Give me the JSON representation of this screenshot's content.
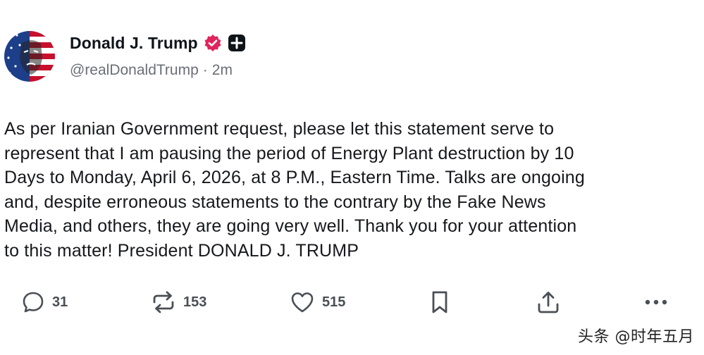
{
  "author": {
    "display_name": "Donald J. Trump",
    "handle": "@realDonaldTrump",
    "separator": "·",
    "time_ago": "2m",
    "verified_color": "#e0245e"
  },
  "post": {
    "lines": [
      "As per Iranian Government request, please let this statement serve to",
      "represent that I am pausing the period of Energy Plant destruction by 10",
      "Days to Monday, April 6, 2026, at 8 P.M., Eastern Time. Talks are ongoing",
      "and, despite erroneous statements to the contrary by the Fake News",
      "Media, and others, they are going very well. Thank you for your attention",
      "to this matter! President DONALD J. TRUMP"
    ]
  },
  "actions": {
    "reply": {
      "icon": "reply-icon",
      "count": "31"
    },
    "repost": {
      "icon": "repost-icon",
      "count": "153"
    },
    "like": {
      "icon": "heart-icon",
      "count": "515"
    },
    "bookmark": {
      "icon": "bookmark-icon"
    },
    "share": {
      "icon": "share-icon"
    },
    "more": {
      "icon": "more-icon"
    }
  },
  "watermark": {
    "text": "头条 @时年五月"
  }
}
